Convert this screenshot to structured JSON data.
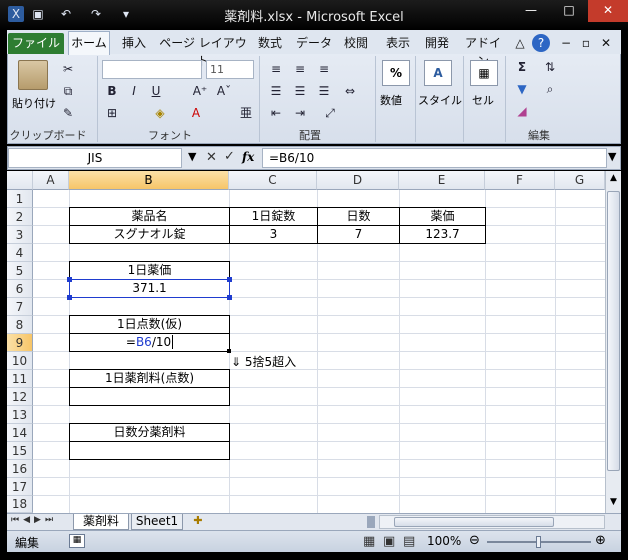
{
  "window": {
    "title": "薬剤料.xlsx - Microsoft Excel",
    "min": "—",
    "max": "□",
    "close": "✕"
  },
  "ribbon": {
    "file_tab": "ファイル",
    "tabs": [
      "ホーム",
      "挿入",
      "ページ レイアウト",
      "数式",
      "データ",
      "校閲",
      "表示",
      "開発",
      "アドイン"
    ],
    "clipboard": {
      "label": "クリップボード",
      "paste": "貼り付け"
    },
    "font": {
      "label": "フォント",
      "name": "",
      "size": "11",
      "bold": "B",
      "italic": "I",
      "underline": "U"
    },
    "alignment": {
      "label": "配置"
    },
    "number": {
      "label": "数値",
      "icon": "%"
    },
    "styles": {
      "label": "スタイル",
      "icon": "A"
    },
    "cells": {
      "label": "セル"
    },
    "editing": {
      "label": "編集"
    }
  },
  "formula_bar": {
    "name_box": "JIS",
    "formula": "=B6/10",
    "fx": "fx"
  },
  "sheet": {
    "columns": [
      "A",
      "B",
      "C",
      "D",
      "E",
      "F",
      "G"
    ],
    "rows": [
      "1",
      "2",
      "3",
      "4",
      "5",
      "6",
      "7",
      "8",
      "9",
      "10",
      "11",
      "12",
      "13",
      "14",
      "15",
      "16",
      "17",
      "18"
    ],
    "table_headers": [
      "薬品名",
      "1日錠数",
      "日数",
      "薬価"
    ],
    "table_values": [
      "スグナオル錠",
      "3",
      "7",
      "123.7"
    ],
    "daily_price_label": "1日薬価",
    "daily_price_value": "371.1",
    "daily_points_label": "1日点数(仮)",
    "edit_prefix": "=",
    "edit_ref": "B6",
    "edit_rest": "/10",
    "rounding_note": "⇓ 5捨5超入",
    "daily_drug_fee_label": "1日薬剤料(点数)",
    "days_drug_fee_label": "日数分薬剤料"
  },
  "sheet_tabs": {
    "active": "薬剤料",
    "other": "Sheet1"
  },
  "status": {
    "mode": "編集",
    "zoom": "100%"
  },
  "colors": {
    "ribbon": "#dfe6f0",
    "file_tab": "#2e7d32",
    "selection": "#1f3ccf"
  }
}
